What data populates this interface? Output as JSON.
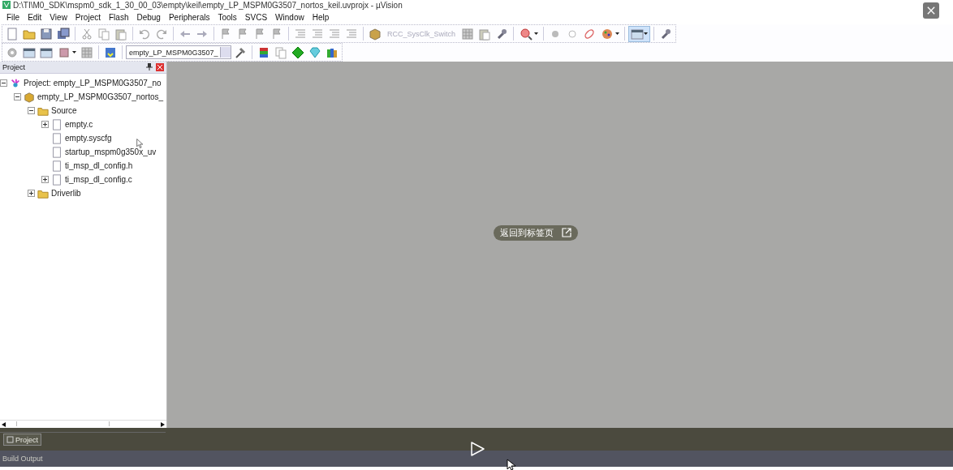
{
  "window": {
    "title": "D:\\TI\\M0_SDK\\mspm0_sdk_1_30_00_03\\empty\\keil\\empty_LP_MSPM0G3507_nortos_keil.uvprojx - µVision"
  },
  "menu": [
    "File",
    "Edit",
    "View",
    "Project",
    "Flash",
    "Debug",
    "Peripherals",
    "Tools",
    "SVCS",
    "Window",
    "Help"
  ],
  "toolbar_1": {
    "target": "RCC_SysClk_Switch"
  },
  "toolbar_2": {
    "target_select": "empty_LP_MSPM0G3507_"
  },
  "project_panel": {
    "title": "Project",
    "tree": [
      {
        "label": "Project: empty_LP_MSPM0G3507_no",
        "kind": "project",
        "expanded": true,
        "children": [
          {
            "label": "empty_LP_MSPM0G3507_nortos_",
            "kind": "target",
            "expanded": true,
            "children": [
              {
                "label": "Source",
                "kind": "folder",
                "expanded": true,
                "children": [
                  {
                    "label": "empty.c",
                    "kind": "file",
                    "expanded": false
                  },
                  {
                    "label": "empty.syscfg",
                    "kind": "file"
                  },
                  {
                    "label": "startup_mspm0g350x_uv",
                    "kind": "file"
                  },
                  {
                    "label": "ti_msp_dl_config.h",
                    "kind": "file"
                  },
                  {
                    "label": "ti_msp_dl_config.c",
                    "kind": "file",
                    "expanded": false
                  }
                ]
              },
              {
                "label": "Driverlib",
                "kind": "folder",
                "expanded": false
              }
            ]
          }
        ]
      }
    ],
    "tabs": [
      {
        "label": "Project",
        "selected": true
      }
    ]
  },
  "build_output": {
    "title": "Build Output"
  },
  "overlay": {
    "label": "返回到标签页"
  }
}
